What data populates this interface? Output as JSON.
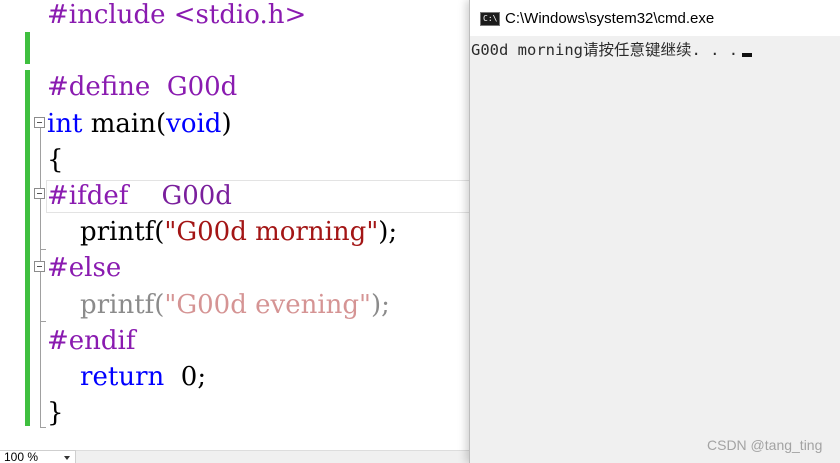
{
  "editor": {
    "lines": [
      {
        "parts": [
          {
            "text": "#include <stdio.h>",
            "style": "pre"
          }
        ]
      },
      {
        "parts": []
      },
      {
        "parts": [
          {
            "text": "#define  G00d",
            "style": "pre"
          }
        ]
      },
      {
        "parts": [
          {
            "text": "int",
            "style": "kw"
          },
          {
            "text": " main(",
            "style": "txt"
          },
          {
            "text": "void",
            "style": "kw"
          },
          {
            "text": ")",
            "style": "txt"
          }
        ]
      },
      {
        "parts": [
          {
            "text": "{",
            "style": "txt"
          }
        ]
      },
      {
        "parts": [
          {
            "text": "#ifdef    ",
            "style": "pre"
          },
          {
            "text": "G00d",
            "style": "macro"
          }
        ]
      },
      {
        "parts": [
          {
            "text": "    printf(",
            "style": "txt"
          },
          {
            "text": "\"G00d morning\"",
            "style": "str"
          },
          {
            "text": ");",
            "style": "txt"
          }
        ]
      },
      {
        "parts": [
          {
            "text": "#else",
            "style": "pre"
          }
        ]
      },
      {
        "parts": [
          {
            "text": "    printf(",
            "style": "txt dim"
          },
          {
            "text": "\"G00d evening\"",
            "style": "str dim"
          },
          {
            "text": ");",
            "style": "txt dim"
          }
        ]
      },
      {
        "parts": [
          {
            "text": "#endif",
            "style": "pre"
          }
        ]
      },
      {
        "parts": [
          {
            "text": "    return",
            "style": "kw"
          },
          {
            "text": "  0;",
            "style": "txt"
          }
        ]
      },
      {
        "parts": [
          {
            "text": "}",
            "style": "txt"
          }
        ]
      }
    ],
    "zoom_level": "100 %"
  },
  "console": {
    "title": "C:\\Windows\\system32\\cmd.exe",
    "icon": "cmd-icon",
    "icon_prompt": "C:\\",
    "output": "G00d morning请按任意键继续. . ."
  },
  "watermark": "CSDN @tang_ting",
  "colors": {
    "preprocessor": "#8a1bb0",
    "keyword": "#0000ff",
    "string": "#a31515",
    "change_bar": "#3fbf3f",
    "console_bg": "#f0f0f0"
  }
}
